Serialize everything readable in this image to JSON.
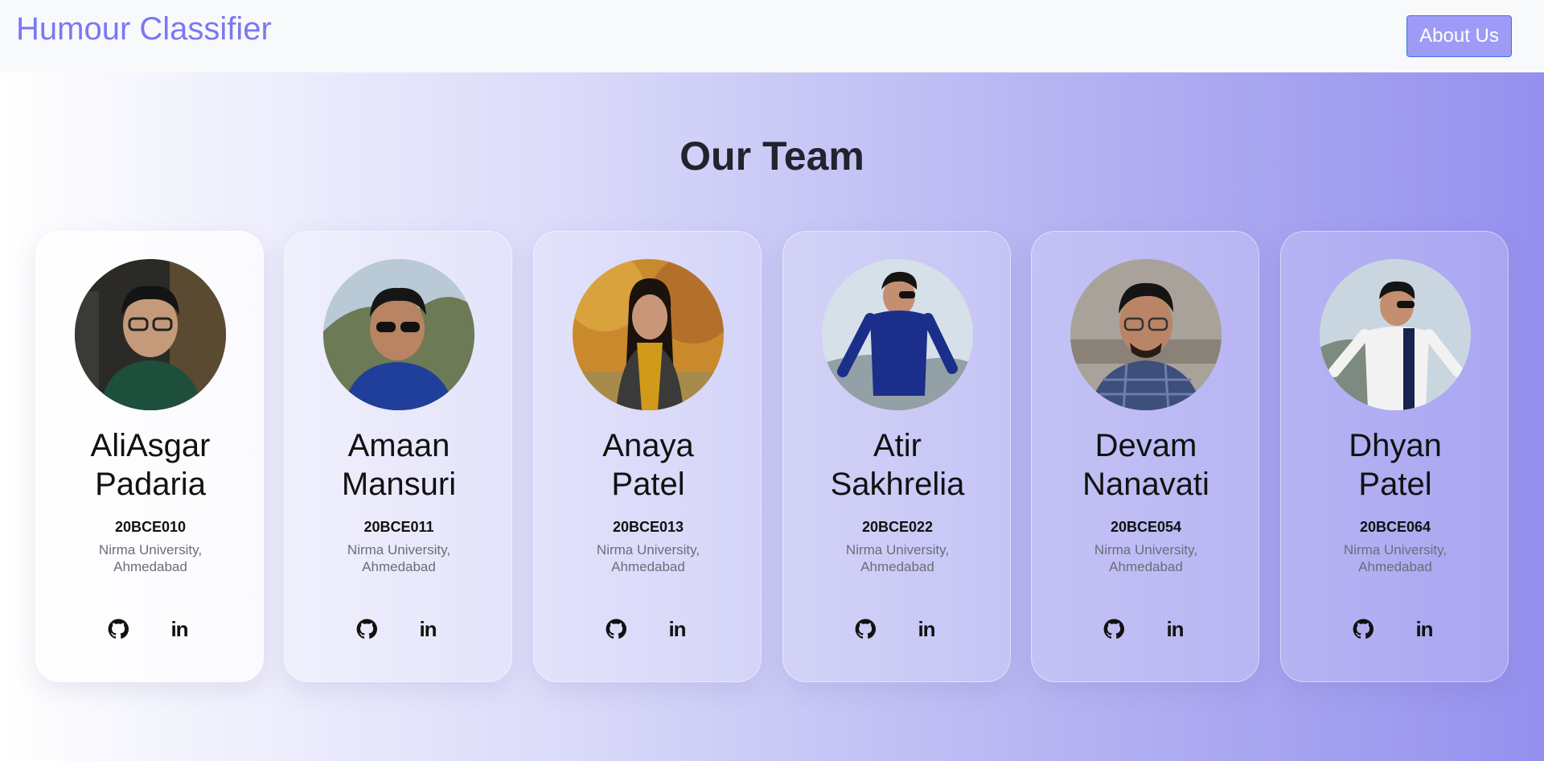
{
  "navbar": {
    "brand": "Humour Classifier",
    "about_label": "About Us"
  },
  "section": {
    "title": "Our Team"
  },
  "team": [
    {
      "name_line1": "AliAsgar",
      "name_line2": "Padaria",
      "roll": "20BCE010",
      "uni_line1": "Nirma University,",
      "uni_line2": "Ahmedabad"
    },
    {
      "name_line1": "Amaan",
      "name_line2": "Mansuri",
      "roll": "20BCE011",
      "uni_line1": "Nirma University,",
      "uni_line2": "Ahmedabad"
    },
    {
      "name_line1": "Anaya",
      "name_line2": "Patel",
      "roll": "20BCE013",
      "uni_line1": "Nirma University,",
      "uni_line2": "Ahmedabad"
    },
    {
      "name_line1": "Atir",
      "name_line2": "Sakhrelia",
      "roll": "20BCE022",
      "uni_line1": "Nirma University,",
      "uni_line2": "Ahmedabad"
    },
    {
      "name_line1": "Devam",
      "name_line2": "Nanavati",
      "roll": "20BCE054",
      "uni_line1": "Nirma University,",
      "uni_line2": "Ahmedabad"
    },
    {
      "name_line1": "Dhyan",
      "name_line2": "Patel",
      "roll": "20BCE064",
      "uni_line1": "Nirma University,",
      "uni_line2": "Ahmedabad"
    }
  ],
  "icons": {
    "github": "github-icon",
    "linkedin": "linkedin-icon",
    "linkedin_glyph": "in"
  },
  "colors": {
    "brand": "#7b78f0",
    "button": "#9e9bf6",
    "button_border": "#3d73e6"
  }
}
